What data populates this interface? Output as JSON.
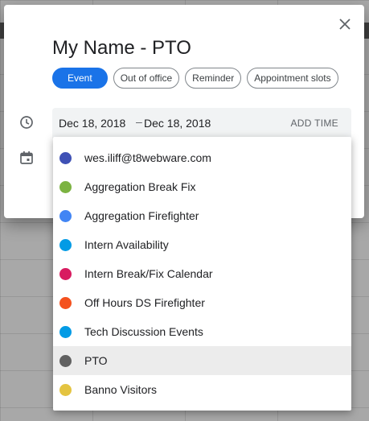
{
  "dialog": {
    "title": "My Name - PTO",
    "chips": [
      {
        "label": "Event",
        "active": true
      },
      {
        "label": "Out of office",
        "active": false
      },
      {
        "label": "Reminder",
        "active": false
      },
      {
        "label": "Appointment slots",
        "active": false
      }
    ],
    "date": {
      "start": "Dec 18, 2018",
      "separator": "–",
      "end": "Dec 18, 2018",
      "add_time": "ADD TIME"
    },
    "icons": {
      "close": "close-icon",
      "time": "clock-icon",
      "calendar": "calendar-icon"
    }
  },
  "calendars": {
    "items": [
      {
        "label": "wes.iliff@t8webware.com",
        "color": "#3f51b5"
      },
      {
        "label": "Aggregation Break Fix",
        "color": "#7cb342"
      },
      {
        "label": "Aggregation Firefighter",
        "color": "#4285f4"
      },
      {
        "label": "Intern Availability",
        "color": "#039be5"
      },
      {
        "label": "Intern Break/Fix Calendar",
        "color": "#d81b60"
      },
      {
        "label": "Off Hours DS Firefighter",
        "color": "#f4511e"
      },
      {
        "label": "Tech Discussion Events",
        "color": "#039be5"
      },
      {
        "label": "PTO",
        "color": "#616161"
      },
      {
        "label": "Banno Visitors",
        "color": "#e4c441"
      }
    ],
    "highlighted": "PTO"
  }
}
